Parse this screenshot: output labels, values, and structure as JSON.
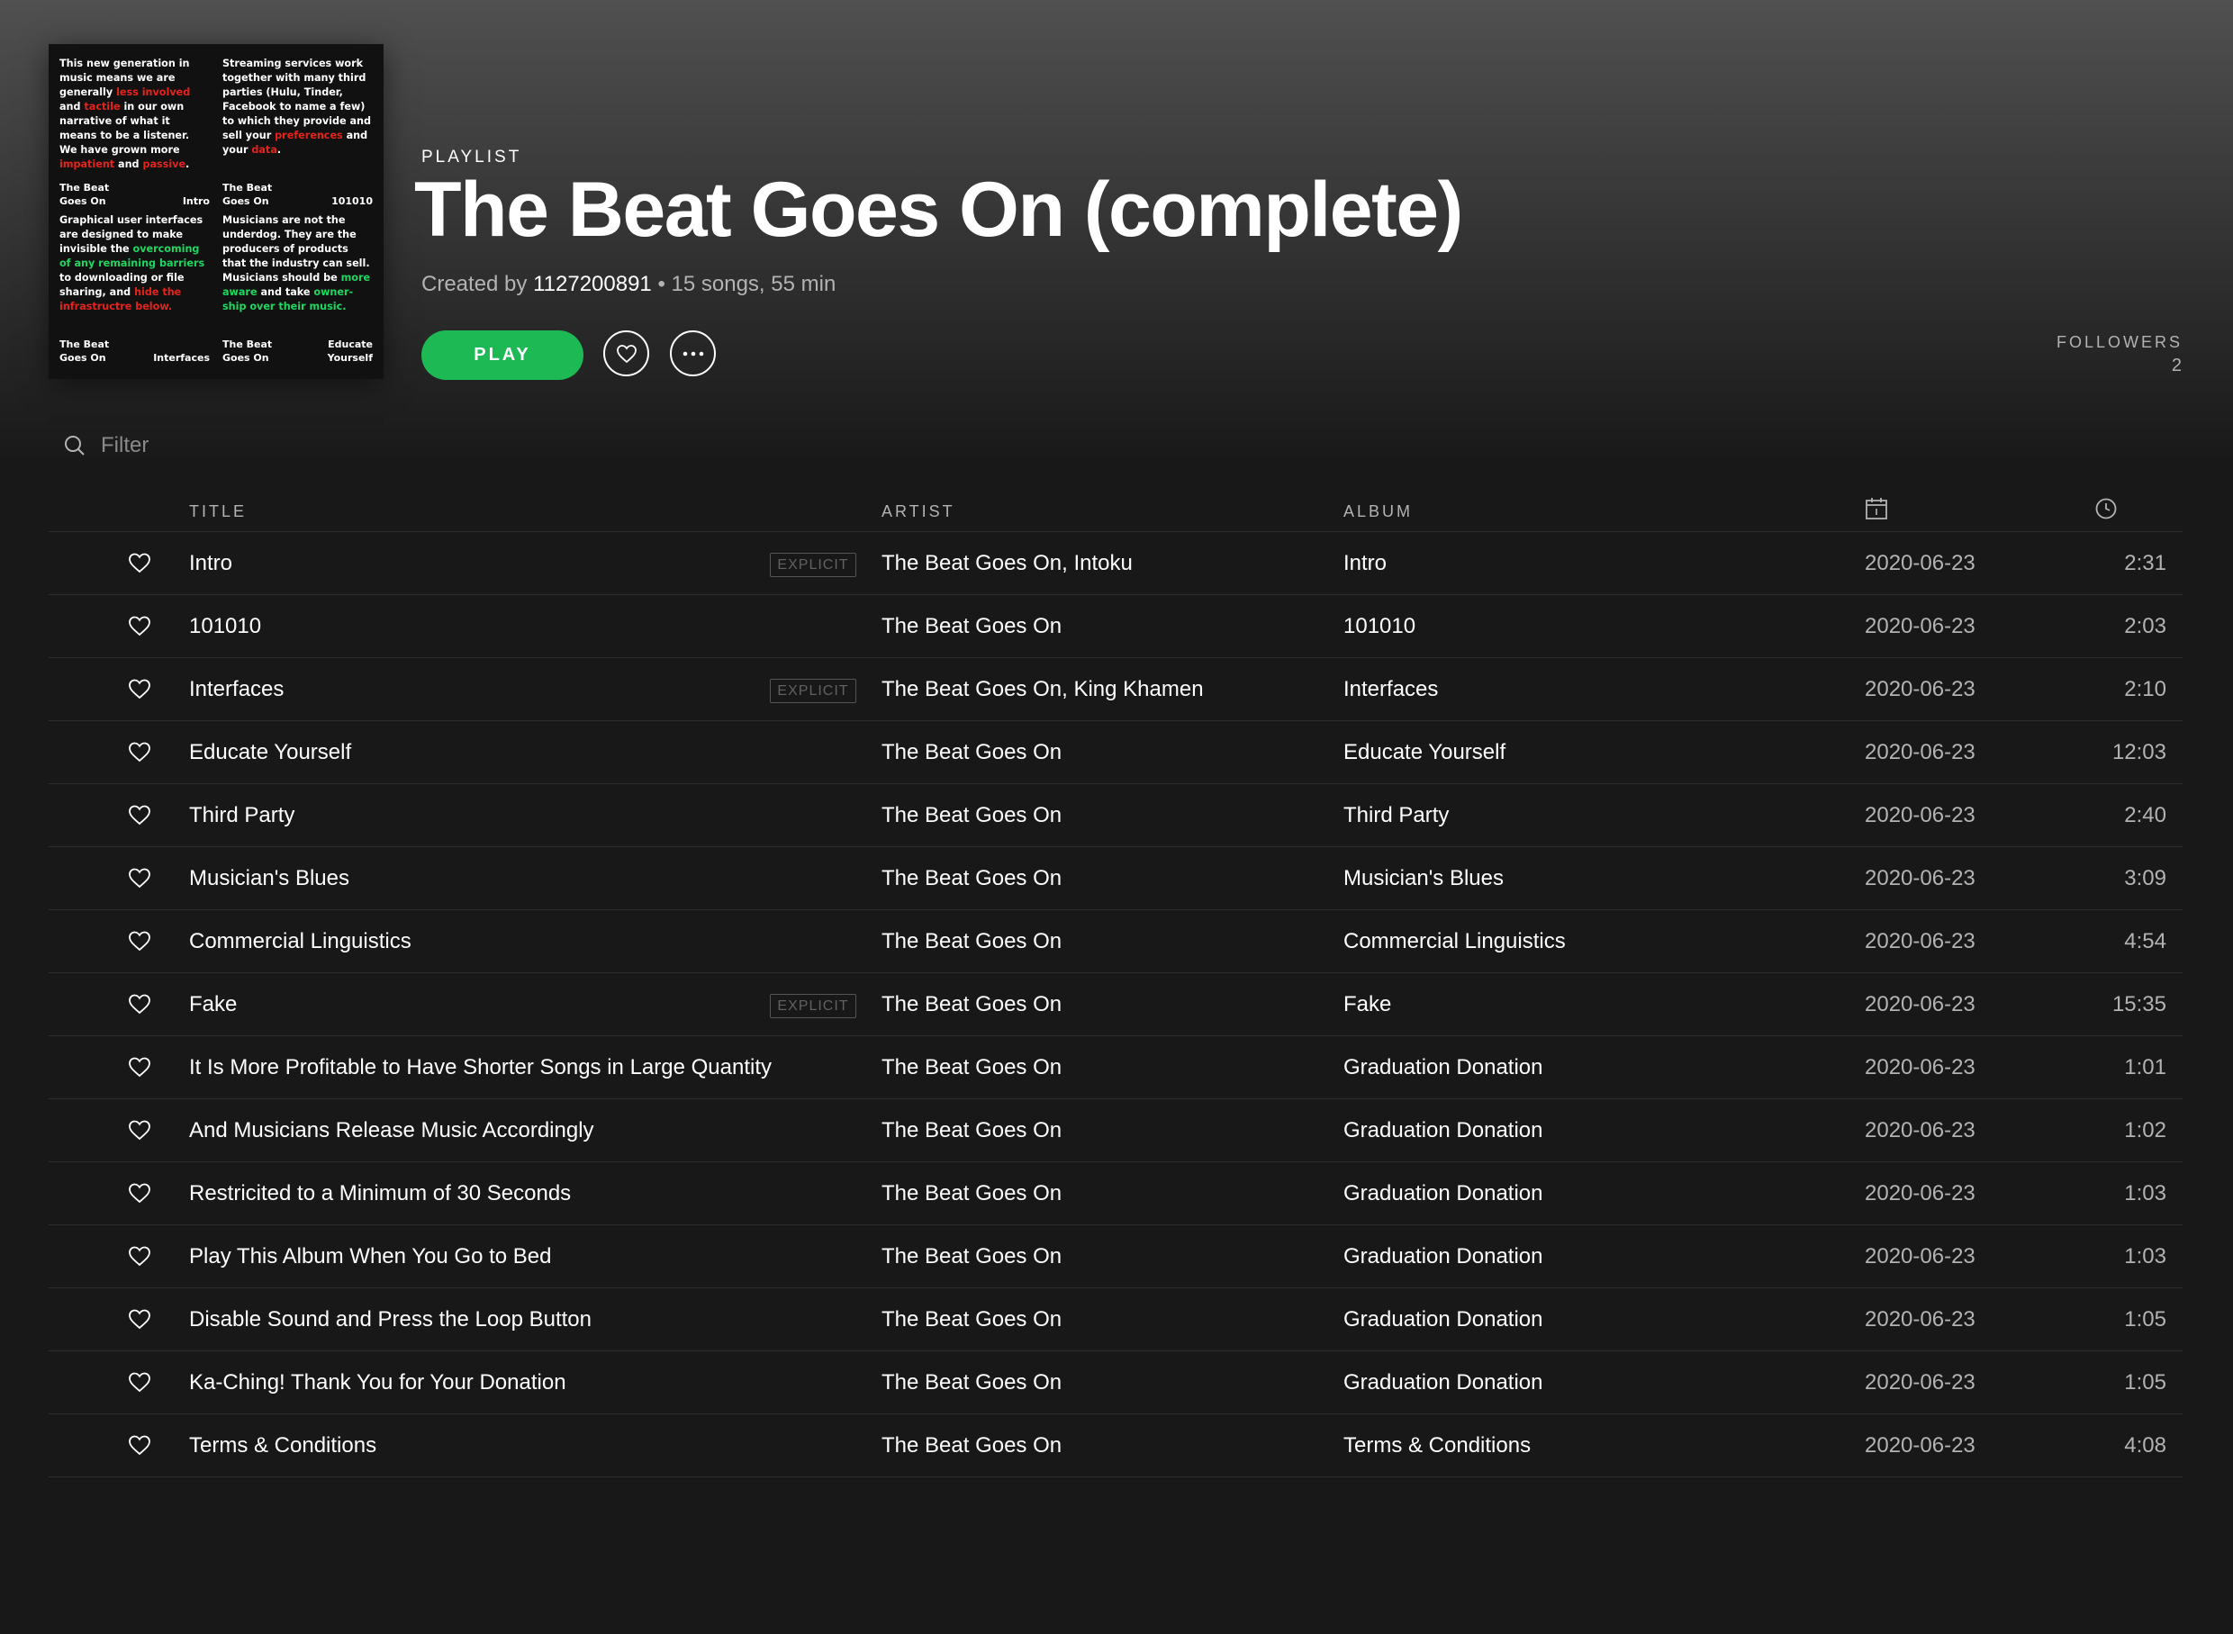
{
  "cover": {
    "tl_parts": [
      {
        "t": "This new generation in music means we are generally ",
        "c": ""
      },
      {
        "t": "less involved",
        "c": "red"
      },
      {
        "t": " and ",
        "c": ""
      },
      {
        "t": "tactile",
        "c": "red"
      },
      {
        "t": " in our own narrative of what it means to be a listener. We have grown more ",
        "c": ""
      },
      {
        "t": "impatient",
        "c": "red"
      },
      {
        "t": " and ",
        "c": ""
      },
      {
        "t": "passive",
        "c": "red"
      },
      {
        "t": ".",
        "c": ""
      }
    ],
    "tl_cap_left": "The Beat\nGoes On",
    "tl_cap_right": "Intro",
    "tr_parts": [
      {
        "t": "Streaming services work together with many third parties (Hulu, Tinder, Facebook to name a few) to which they provide and sell your ",
        "c": ""
      },
      {
        "t": "preferences",
        "c": "red"
      },
      {
        "t": " and your ",
        "c": ""
      },
      {
        "t": "data",
        "c": "red"
      },
      {
        "t": ".",
        "c": ""
      }
    ],
    "tr_cap_left": "The Beat\nGoes On",
    "tr_cap_right": "101010",
    "bl_parts": [
      {
        "t": "Graphical user interfaces are designed to make invisible the ",
        "c": ""
      },
      {
        "t": "overcoming of any remaining barriers",
        "c": "green"
      },
      {
        "t": " to downloading or file sharing, and ",
        "c": ""
      },
      {
        "t": "hide the infrastructre below.",
        "c": "red"
      }
    ],
    "bl_cap_left": "The Beat\nGoes On",
    "bl_cap_right": "Interfaces",
    "br_parts": [
      {
        "t": "Musicians are not the underdog. They are the producers of products that the industry can sell. Musicians should be ",
        "c": ""
      },
      {
        "t": "more aware",
        "c": "green"
      },
      {
        "t": " and take ",
        "c": ""
      },
      {
        "t": "owner-ship over their music.",
        "c": "green"
      }
    ],
    "br_cap_left": "The Beat\nGoes On",
    "br_cap_right": "Educate\nYourself"
  },
  "header": {
    "type_label": "PLAYLIST",
    "title": "The Beat Goes On (complete)",
    "created_by_label": "Created by",
    "owner": "1127200891",
    "summary": "• 15 songs, 55 min",
    "play_label": "PLAY",
    "followers_label": "FOLLOWERS",
    "followers_count": "2"
  },
  "filter": {
    "placeholder": "Filter"
  },
  "columns": {
    "title": "TITLE",
    "artist": "ARTIST",
    "album": "ALBUM"
  },
  "explicit_label": "EXPLICIT",
  "colors": {
    "accent": "#1db954",
    "background": "#181818"
  },
  "tracks": [
    {
      "title": "Intro",
      "explicit": true,
      "artist": "The Beat Goes On, Intoku",
      "album": "Intro",
      "date": "2020-06-23",
      "duration": "2:31"
    },
    {
      "title": "101010",
      "explicit": false,
      "artist": "The Beat Goes On",
      "album": "101010",
      "date": "2020-06-23",
      "duration": "2:03"
    },
    {
      "title": "Interfaces",
      "explicit": true,
      "artist": "The Beat Goes On, King Khamen",
      "album": "Interfaces",
      "date": "2020-06-23",
      "duration": "2:10"
    },
    {
      "title": "Educate Yourself",
      "explicit": false,
      "artist": "The Beat Goes On",
      "album": "Educate Yourself",
      "date": "2020-06-23",
      "duration": "12:03"
    },
    {
      "title": "Third Party",
      "explicit": false,
      "artist": "The Beat Goes On",
      "album": "Third Party",
      "date": "2020-06-23",
      "duration": "2:40"
    },
    {
      "title": "Musician's Blues",
      "explicit": false,
      "artist": "The Beat Goes On",
      "album": "Musician's Blues",
      "date": "2020-06-23",
      "duration": "3:09"
    },
    {
      "title": "Commercial Linguistics",
      "explicit": false,
      "artist": "The Beat Goes On",
      "album": "Commercial Linguistics",
      "date": "2020-06-23",
      "duration": "4:54"
    },
    {
      "title": "Fake",
      "explicit": true,
      "artist": "The Beat Goes On",
      "album": "Fake",
      "date": "2020-06-23",
      "duration": "15:35"
    },
    {
      "title": "It Is More Profitable to Have Shorter Songs in Large Quantity",
      "explicit": false,
      "artist": "The Beat Goes On",
      "album": "Graduation Donation",
      "date": "2020-06-23",
      "duration": "1:01"
    },
    {
      "title": "And Musicians Release Music Accordingly",
      "explicit": false,
      "artist": "The Beat Goes On",
      "album": "Graduation Donation",
      "date": "2020-06-23",
      "duration": "1:02"
    },
    {
      "title": "Restricited to a Minimum of 30 Seconds",
      "explicit": false,
      "artist": "The Beat Goes On",
      "album": "Graduation Donation",
      "date": "2020-06-23",
      "duration": "1:03"
    },
    {
      "title": "Play This Album When You Go to Bed",
      "explicit": false,
      "artist": "The Beat Goes On",
      "album": "Graduation Donation",
      "date": "2020-06-23",
      "duration": "1:03"
    },
    {
      "title": "Disable Sound and Press the Loop Button",
      "explicit": false,
      "artist": "The Beat Goes On",
      "album": "Graduation Donation",
      "date": "2020-06-23",
      "duration": "1:05"
    },
    {
      "title": "Ka-Ching! Thank You for Your Donation",
      "explicit": false,
      "artist": "The Beat Goes On",
      "album": "Graduation Donation",
      "date": "2020-06-23",
      "duration": "1:05"
    },
    {
      "title": "Terms & Conditions",
      "explicit": false,
      "artist": "The Beat Goes On",
      "album": "Terms & Conditions",
      "date": "2020-06-23",
      "duration": "4:08"
    }
  ]
}
